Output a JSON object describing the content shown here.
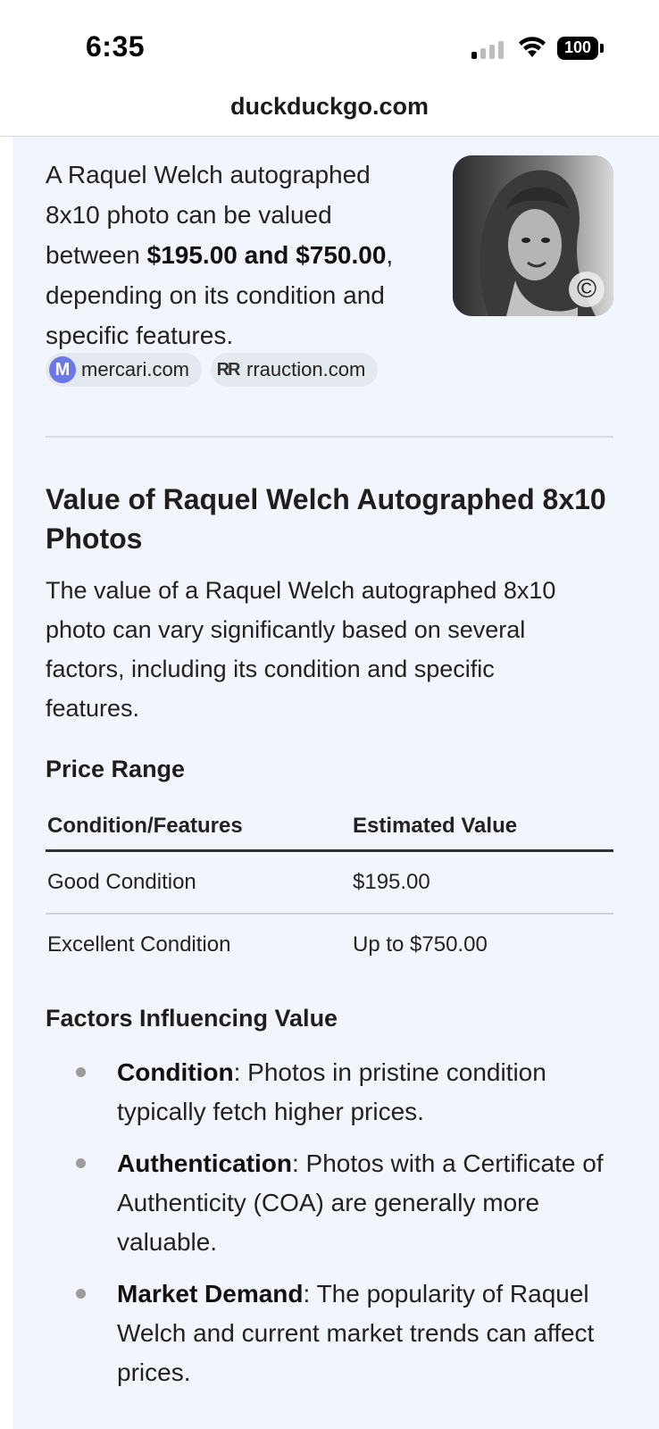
{
  "status_bar": {
    "time": "6:35",
    "battery": "100"
  },
  "browser": {
    "url": "duckduckgo.com"
  },
  "answer": {
    "intro_lead": "A Raquel Welch autographed 8x10 photo can be valued between ",
    "intro_bold": "$195.00 and $750.00",
    "intro_tail": ", depending on its condition and specific features.",
    "image_icon": "copyright-icon",
    "sources": [
      {
        "icon_text": "M",
        "label": "mercari.com"
      },
      {
        "icon_text": "RR",
        "label": "rrauction.com"
      }
    ]
  },
  "article": {
    "title": "Value of Raquel Welch Autographed 8x10 Photos",
    "paragraph": "The value of a Raquel Welch autographed 8x10 photo can vary significantly based on several factors, including its condition and specific features.",
    "price_range_heading": "Price Range",
    "table": {
      "headers": [
        "Condition/Features",
        "Estimated Value"
      ],
      "rows": [
        [
          "Good Condition",
          "$195.00"
        ],
        [
          "Excellent Condition",
          "Up to $750.00"
        ]
      ]
    },
    "factors_heading": "Factors Influencing Value",
    "factors": [
      {
        "term": "Condition",
        "desc": ": Photos in pristine condition typically fetch higher prices."
      },
      {
        "term": "Authentication",
        "desc": ": Photos with a Certificate of Authenticity (COA) are generally more valuable."
      },
      {
        "term": "Market Demand",
        "desc": ": The popularity of Raquel Welch and current market trends can affect prices."
      }
    ]
  }
}
